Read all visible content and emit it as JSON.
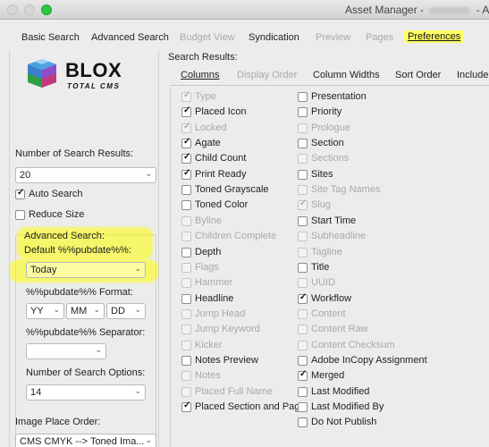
{
  "window": {
    "title": "Asset Manager - ",
    "title_suffix": " - A"
  },
  "tabs": [
    {
      "label": "Basic Search",
      "state": "normal"
    },
    {
      "label": "Advanced Search",
      "state": "normal"
    },
    {
      "label": "Budget View",
      "state": "disabled"
    },
    {
      "label": "Syndication",
      "state": "normal"
    },
    {
      "label": "Preview",
      "state": "disabled"
    },
    {
      "label": "Pages",
      "state": "disabled"
    },
    {
      "label": "Preferences",
      "state": "active"
    }
  ],
  "logo": {
    "main": "BLOX",
    "sub": "TOTAL CMS"
  },
  "left": {
    "num_results_label": "Number of Search Results:",
    "num_results_value": "20",
    "auto_search_label": "Auto Search",
    "auto_search_checked": true,
    "reduce_size_label": "Reduce Size",
    "reduce_size_checked": false,
    "advanced_group_label": "Advanced Search:",
    "default_pubdate_label": "Default %%pubdate%%:",
    "default_pubdate_value": "Today",
    "pubdate_format_label": "%%pubdate%% Format:",
    "format_yy": "YY",
    "format_mm": "MM",
    "format_dd": "DD",
    "separator_label": "%%pubdate%% Separator:",
    "separator_value": "",
    "num_options_label": "Number of Search Options:",
    "num_options_value": "14",
    "image_place_label": "Image Place Order:",
    "image_place_value": "CMS CMYK --> Toned Ima..."
  },
  "right": {
    "title": "Search Results:",
    "subtabs": [
      {
        "label": "Columns",
        "state": "active"
      },
      {
        "label": "Display Order",
        "state": "disabled"
      },
      {
        "label": "Column Widths",
        "state": "normal"
      },
      {
        "label": "Sort Order",
        "state": "normal"
      },
      {
        "label": "Include",
        "state": "normal"
      }
    ],
    "columns_left": [
      {
        "label": "Type",
        "checked": true,
        "disabled": true
      },
      {
        "label": "Placed Icon",
        "checked": true,
        "disabled": false
      },
      {
        "label": "Locked",
        "checked": true,
        "disabled": true
      },
      {
        "label": "Agate",
        "checked": true,
        "disabled": false
      },
      {
        "label": "Child Count",
        "checked": true,
        "disabled": false
      },
      {
        "label": "Print Ready",
        "checked": true,
        "disabled": false
      },
      {
        "label": "Toned Grayscale",
        "checked": false,
        "disabled": false
      },
      {
        "label": "Toned Color",
        "checked": false,
        "disabled": false
      },
      {
        "label": "Byline",
        "checked": false,
        "disabled": true
      },
      {
        "label": "Children Complete",
        "checked": false,
        "disabled": true
      },
      {
        "label": "Depth",
        "checked": false,
        "disabled": false
      },
      {
        "label": "Flags",
        "checked": false,
        "disabled": true
      },
      {
        "label": "Hammer",
        "checked": false,
        "disabled": true
      },
      {
        "label": "Headline",
        "checked": false,
        "disabled": false
      },
      {
        "label": "Jump Head",
        "checked": false,
        "disabled": true
      },
      {
        "label": "Jump Keyword",
        "checked": false,
        "disabled": true
      },
      {
        "label": "Kicker",
        "checked": false,
        "disabled": true
      },
      {
        "label": "Notes Preview",
        "checked": false,
        "disabled": false
      },
      {
        "label": "Notes",
        "checked": false,
        "disabled": true
      },
      {
        "label": "Placed Full Name",
        "checked": false,
        "disabled": true
      },
      {
        "label": "Placed Section and Page",
        "checked": true,
        "disabled": false
      }
    ],
    "columns_right": [
      {
        "label": "Presentation",
        "checked": false,
        "disabled": false
      },
      {
        "label": "Priority",
        "checked": false,
        "disabled": false
      },
      {
        "label": "Prologue",
        "checked": false,
        "disabled": true
      },
      {
        "label": "Section",
        "checked": false,
        "disabled": false
      },
      {
        "label": "Sections",
        "checked": false,
        "disabled": true
      },
      {
        "label": "Sites",
        "checked": false,
        "disabled": false
      },
      {
        "label": "Site Tag Names",
        "checked": false,
        "disabled": true
      },
      {
        "label": "Slug",
        "checked": true,
        "disabled": true
      },
      {
        "label": "Start Time",
        "checked": false,
        "disabled": false
      },
      {
        "label": "Subheadline",
        "checked": false,
        "disabled": true
      },
      {
        "label": "Tagline",
        "checked": false,
        "disabled": true
      },
      {
        "label": "Title",
        "checked": false,
        "disabled": false
      },
      {
        "label": "UUID",
        "checked": false,
        "disabled": true
      },
      {
        "label": "Workflow",
        "checked": true,
        "disabled": false
      },
      {
        "label": "Content",
        "checked": false,
        "disabled": true
      },
      {
        "label": "Content Raw",
        "checked": false,
        "disabled": true
      },
      {
        "label": "Content Checksum",
        "checked": false,
        "disabled": true
      },
      {
        "label": "Adobe InCopy Assignment",
        "checked": false,
        "disabled": false
      },
      {
        "label": "Merged",
        "checked": true,
        "disabled": false
      },
      {
        "label": "Last Modified",
        "checked": false,
        "disabled": false
      },
      {
        "label": "Last Modified By",
        "checked": false,
        "disabled": false
      },
      {
        "label": "Do Not Publish",
        "checked": false,
        "disabled": false
      }
    ]
  },
  "colors": {
    "highlight": "#ffff00",
    "window_bg": "#ececec",
    "maximize_green": "#2bc840"
  }
}
